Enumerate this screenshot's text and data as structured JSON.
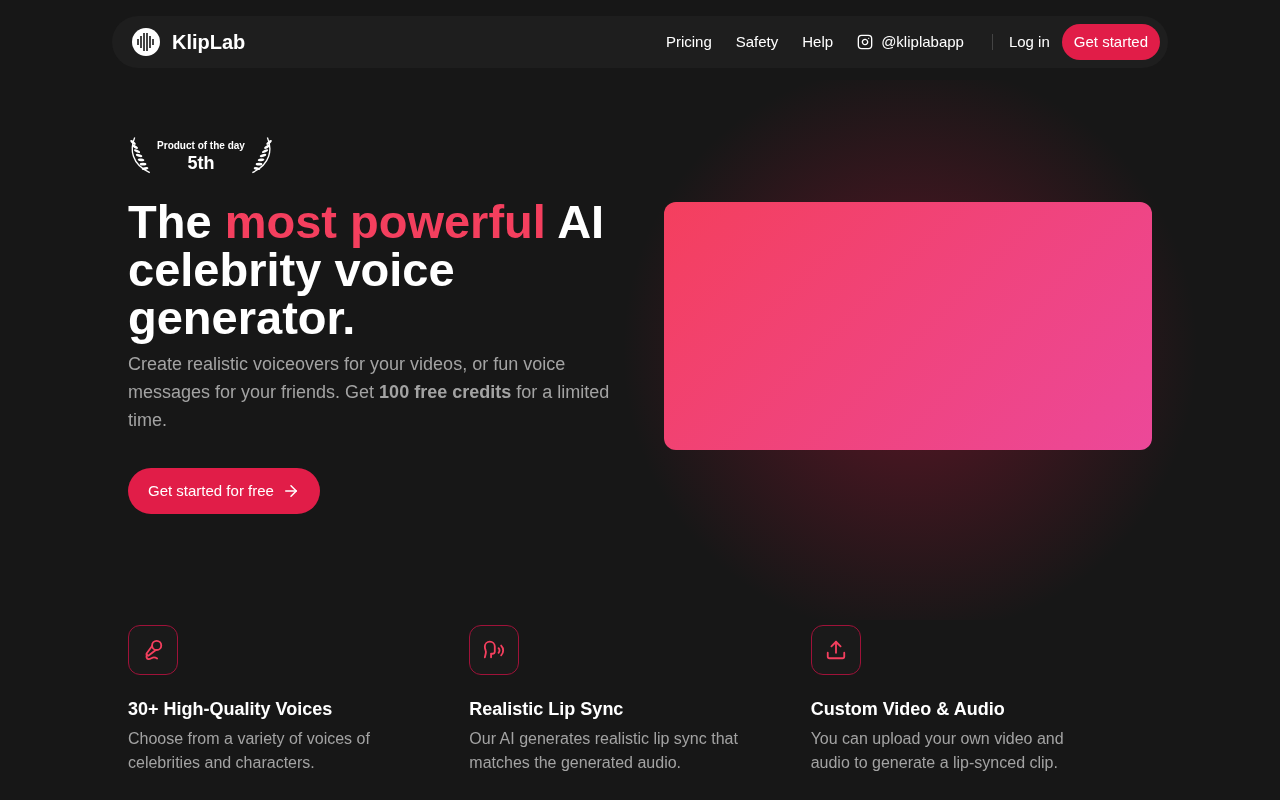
{
  "header": {
    "brand": "KlipLab",
    "nav": [
      {
        "label": "Pricing",
        "kind": "link"
      },
      {
        "label": "Safety",
        "kind": "link"
      },
      {
        "label": "Help",
        "kind": "link"
      },
      {
        "label": "@kliplabapp",
        "kind": "social"
      }
    ],
    "login": "Log in",
    "cta": "Get started"
  },
  "hero": {
    "award": {
      "title": "Product of the day",
      "rank": "5th"
    },
    "headline": [
      {
        "text": "The ",
        "accent": false
      },
      {
        "text": "most powerful",
        "accent": true
      },
      {
        "text": " AI celebrity voice generator.",
        "accent": false
      }
    ],
    "description": "Create realistic voiceovers for your videos, or fun voice messages for your friends. Get **100 free credits** for a limited time.",
    "cta": "Get started for free"
  },
  "features": [
    {
      "title": "30+ High-Quality Voices",
      "text": "Choose from a variety of voices of celebrities and characters."
    },
    {
      "title": "Realistic Lip Sync",
      "text": "Our AI generates realistic lip sync that matches the generated audio."
    },
    {
      "title": "Custom Video & Audio",
      "text": "You can upload your own video and audio to generate a lip-synced clip."
    }
  ]
}
